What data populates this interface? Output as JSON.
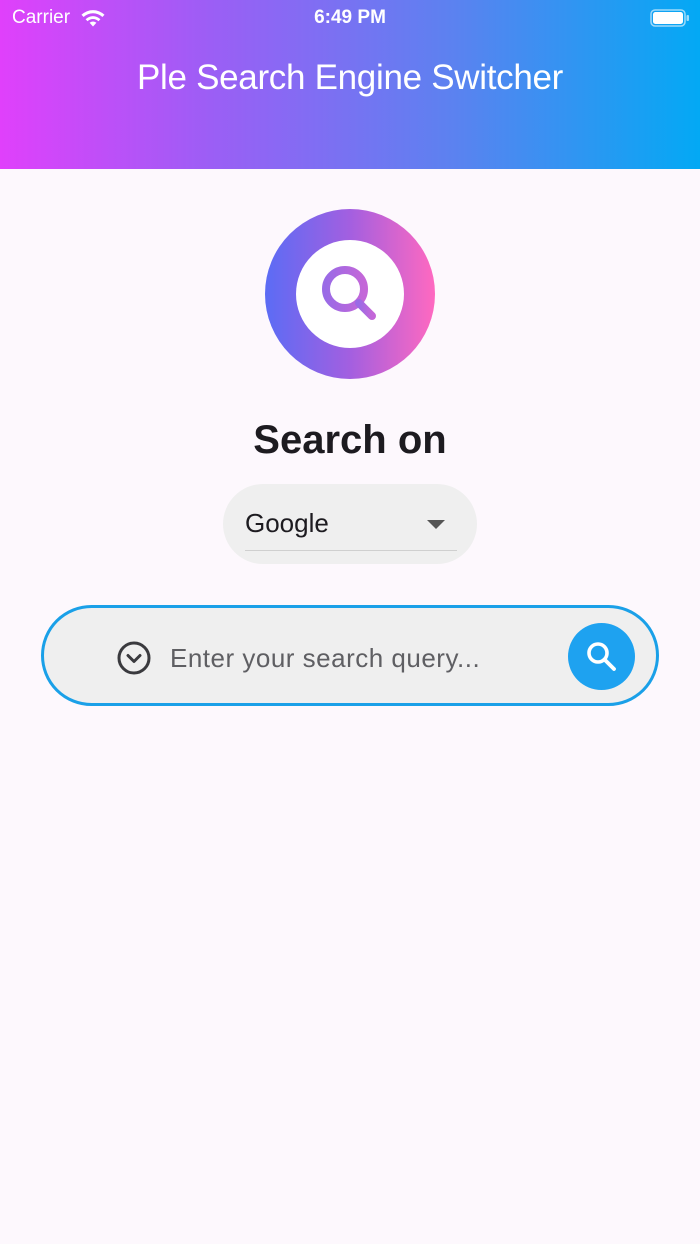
{
  "status_bar": {
    "carrier": "Carrier",
    "time": "6:49 PM",
    "icons": [
      "wifi-icon",
      "battery-icon"
    ]
  },
  "app_bar": {
    "title": "Ple Search Engine Switcher",
    "gradient": [
      "#e040fb",
      "#03a9f4"
    ]
  },
  "logo": {
    "icon": "search-logo-icon",
    "gradient": [
      "#5b6cf5",
      "#ff69c0"
    ]
  },
  "heading": "Search on",
  "engine_select": {
    "selected": "Google",
    "icon": "dropdown-caret-icon"
  },
  "search": {
    "placeholder": "Enter your search query...",
    "value": "",
    "expand_icon": "chevron-down-circle-icon",
    "button_icon": "search-icon",
    "accent": "#1ea2f0"
  },
  "colors": {
    "background": "#fdf8fd",
    "border_accent": "#1aa0e8"
  }
}
